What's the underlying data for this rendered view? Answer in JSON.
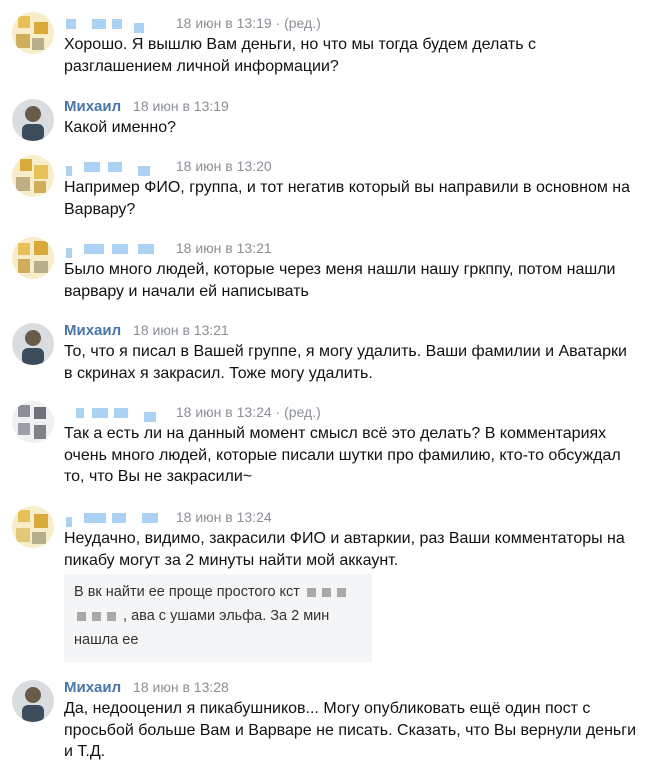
{
  "messages": [
    {
      "author_visible": false,
      "time": "18 июн в 13:19",
      "edited": "· (ред.)",
      "text": "Хорошо. Я вышлю Вам деньги, но что мы тогда будем делать с разглашением личной информации?"
    },
    {
      "author_visible": true,
      "author": "Михаил",
      "time": "18 июн в 13:19",
      "edited": "",
      "text": "Какой именно?"
    },
    {
      "author_visible": false,
      "time": "18 июн в 13:20",
      "edited": "",
      "text": "Например ФИО, группа, и тот негатив который вы направили в основном на Варвару?"
    },
    {
      "author_visible": false,
      "time": "18 июн в 13:21",
      "edited": "",
      "text": "Было много людей, которые через меня нашли нашу гркппу, потом нашли варвару и начали ей написывать"
    },
    {
      "author_visible": true,
      "author": "Михаил",
      "time": "18 июн в 13:21",
      "edited": "",
      "text": "То, что я писал в Вашей группе, я могу удалить. Ваши фамилии и Аватарки в скринах я закрасил. Тоже могу удалить."
    },
    {
      "author_visible": false,
      "time": "18 июн в 13:24",
      "edited": "· (ред.)",
      "text": "Так а есть ли на данный момент смысл всё это делать? В комментариях очень много людей, которые писали шутки про фамилию, кто-то обсуждал то, что Вы не закрасили~"
    },
    {
      "author_visible": false,
      "time": "18 июн в 13:24",
      "edited": "",
      "text": "Неудачно, видимо, закрасили ФИО и автаркии, раз Ваши комментаторы на пикабу могут за 2 минуты найти мой аккаунт.",
      "quote": {
        "line1": "В вк найти ее проще простого кст",
        "line2": ", ава с ушами эльфа. За 2 мин",
        "line3": "нашла ее"
      }
    },
    {
      "author_visible": true,
      "author": "Михаил",
      "time": "18 июн в 13:28",
      "edited": "",
      "text": "Да, недооценил я пикабушников... Могу опубликовать ещё один пост с просьбой больше Вам и Варваре не писать. Сказать, что Вы вернули деньги и Т.Д."
    }
  ]
}
